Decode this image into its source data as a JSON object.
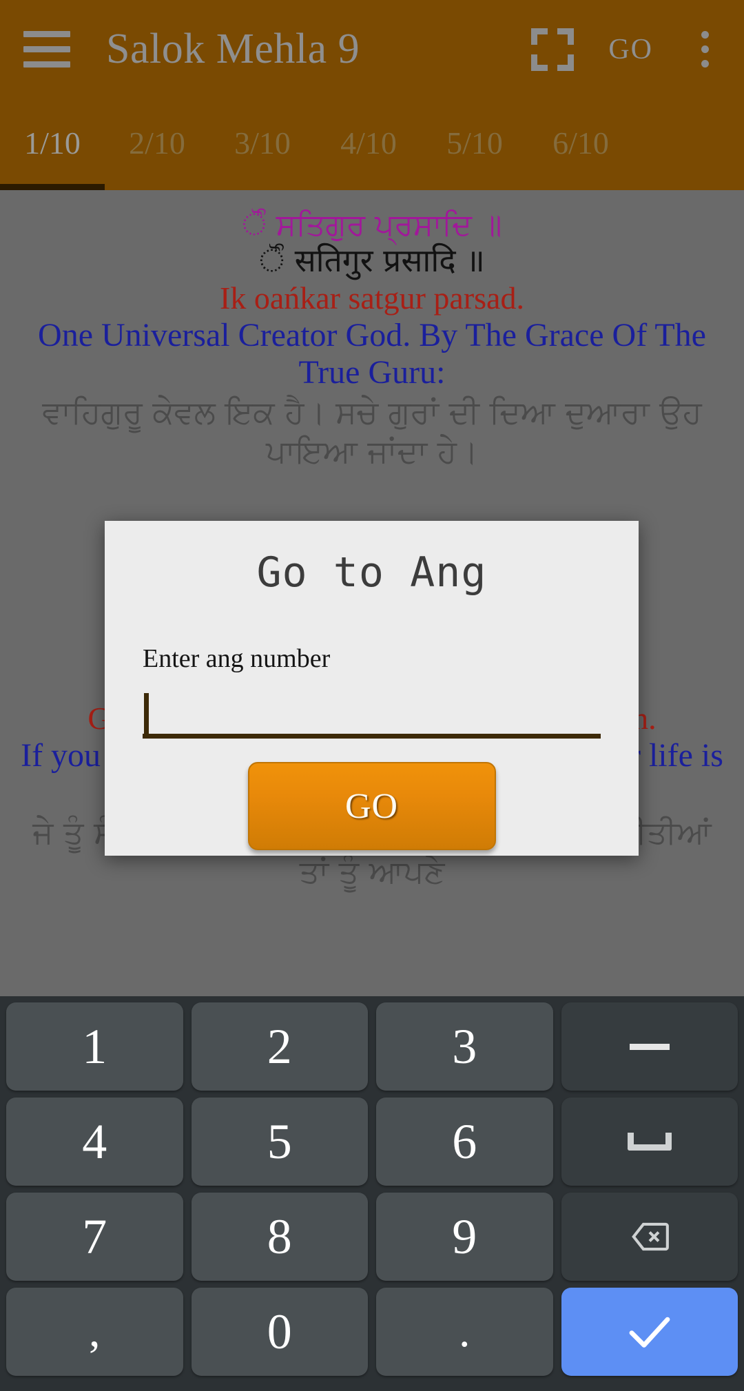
{
  "appbar": {
    "menu_icon": "hamburger-menu-icon",
    "title": "Salok Mehla 9",
    "fullscreen_icon": "fullscreen-icon",
    "go_label": "GO",
    "overflow_icon": "more-vertical-icon"
  },
  "tabs": {
    "items": [
      {
        "label": "1/10",
        "active": true
      },
      {
        "label": "2/10",
        "active": false
      },
      {
        "label": "3/10",
        "active": false
      },
      {
        "label": "4/10",
        "active": false
      },
      {
        "label": "5/10",
        "active": false
      },
      {
        "label": "6/10",
        "active": false
      }
    ]
  },
  "content": {
    "lines": [
      {
        "id": "gurmukhi",
        "text": "਍ੋੰ ਸਤਿਗੁਰ ਪ੍ਰਸਾਦਿ ॥"
      },
      {
        "id": "devanagari",
        "text": "਍ੋੰ सतिगुर प्रसादि ॥"
      },
      {
        "id": "transliteration",
        "text": "Ik oańkar satgur parsad."
      },
      {
        "id": "english",
        "text": "One Universal Creator God. By The Grace Of The True Guru:"
      },
      {
        "id": "punjabi",
        "text": "ਵਾਹਿਗੁਰੂ ਕੇਵਲ ਇਕ ਹੈ। ਸਚੇ ਗੁਰਾਂ ਦੀ ਦਿਆ ਦੁਆਰਾ ਉਹ ਪਾਇਆ ਜਾਂਦਾ ਹੇ।"
      }
    ],
    "lines_below": [
      {
        "id": "transliteration-2",
        "text": "Gur gobind gun ga-e nahi janam akarath kin."
      },
      {
        "id": "english-2",
        "text": "If you do not sing the Praises of the Lord, your life is rendered useless."
      },
      {
        "id": "punjabi-2",
        "text": "ਜੇ ਤੂੰ ਸੰਸਾਰ ਦੇ ਸੁਆਮੀ ਦੀਆਂ ਸਿਫ਼ਤਾਂ ਗਾਇਨ ਨਹੀਂ ਕੀਤੀਆਂ ਤਾਂ ਤੂੰ ਆਪਣੇ"
      }
    ]
  },
  "dialog": {
    "title": "Go to Ang",
    "field_label": "Enter ang number",
    "field_value": "",
    "field_placeholder": "",
    "go_button": "GO"
  },
  "keyboard": {
    "rows": [
      [
        {
          "label": "1",
          "type": "digit"
        },
        {
          "label": "2",
          "type": "digit"
        },
        {
          "label": "3",
          "type": "digit"
        },
        {
          "label": "–",
          "type": "dash",
          "icon": "minus-icon"
        }
      ],
      [
        {
          "label": "4",
          "type": "digit"
        },
        {
          "label": "5",
          "type": "digit"
        },
        {
          "label": "6",
          "type": "digit"
        },
        {
          "label": "",
          "type": "space",
          "icon": "space-icon"
        }
      ],
      [
        {
          "label": "7",
          "type": "digit"
        },
        {
          "label": "8",
          "type": "digit"
        },
        {
          "label": "9",
          "type": "digit"
        },
        {
          "label": "",
          "type": "backspace",
          "icon": "backspace-icon"
        }
      ],
      [
        {
          "label": ",",
          "type": "punct"
        },
        {
          "label": "0",
          "type": "digit"
        },
        {
          "label": ".",
          "type": "punct"
        },
        {
          "label": "",
          "type": "enter",
          "icon": "check-icon"
        }
      ]
    ]
  },
  "colors": {
    "appbar": "#7a4a02",
    "accent_orange": "#e8890a",
    "scrim": "#6a6a6a",
    "dialog_bg": "#ececec",
    "keyboard_bg": "#2c3134",
    "key_bg": "#4a5053",
    "enter_key": "#5d8ff4",
    "gurmukhi": "#a1189a",
    "transliteration": "#a81f15",
    "english": "#1a1f9c"
  }
}
